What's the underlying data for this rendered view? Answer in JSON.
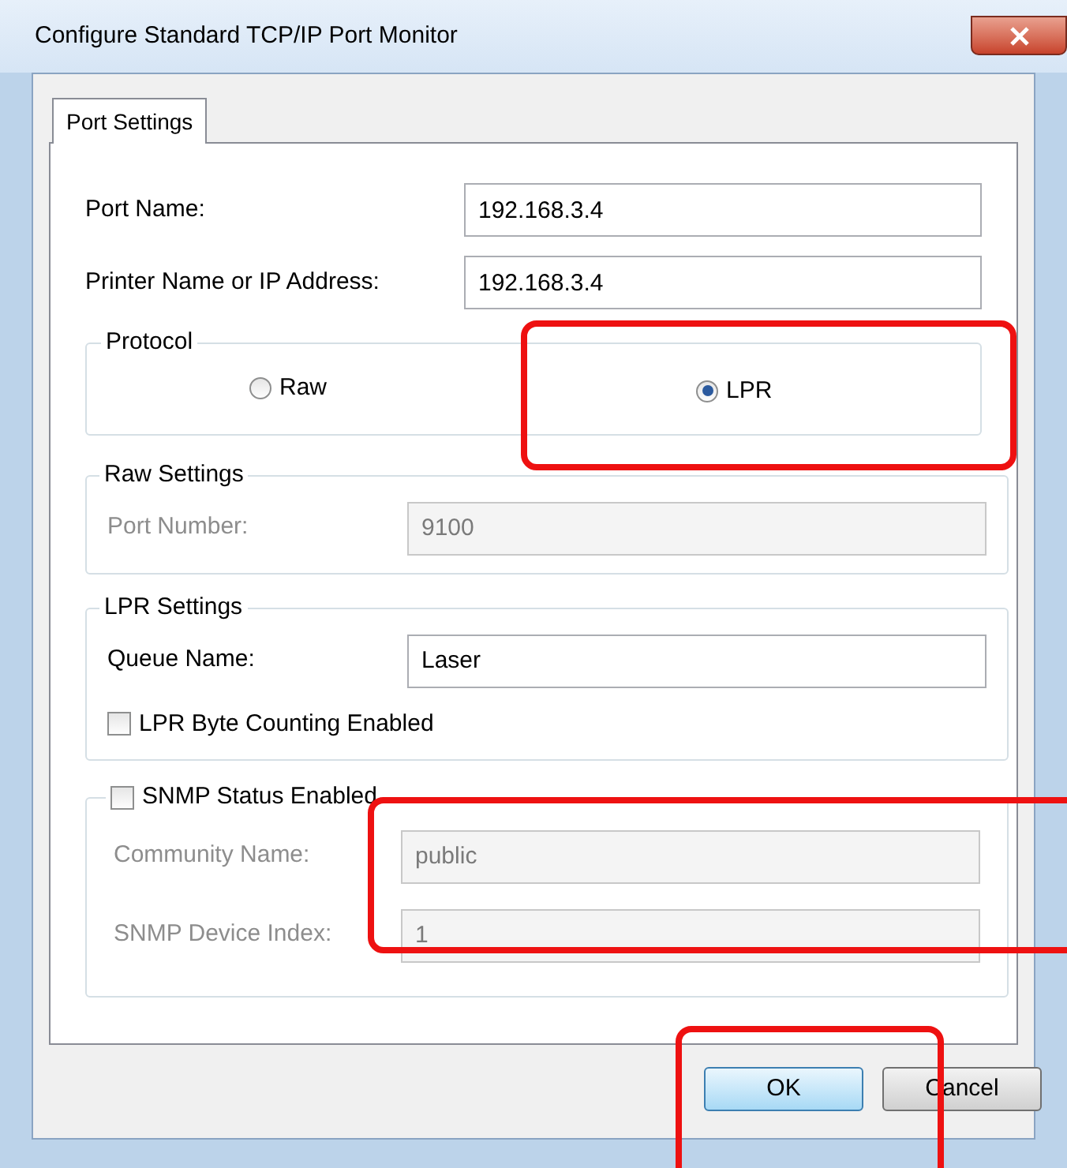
{
  "window": {
    "title": "Configure Standard TCP/IP Port Monitor"
  },
  "tabs": [
    {
      "label": "Port Settings",
      "selected": true
    }
  ],
  "fields": [
    {
      "label": "Port Name:",
      "value": "192.168.3.4"
    },
    {
      "label": "Printer Name or IP Address:",
      "value": "192.168.3.4"
    }
  ],
  "protocol": {
    "title": "Protocol",
    "options": [
      {
        "label": "Raw",
        "selected": false
      },
      {
        "label": "LPR",
        "selected": true
      }
    ]
  },
  "raw_settings": {
    "title": "Raw Settings",
    "disabled": true,
    "port_number": {
      "label": "Port Number:",
      "value": "9100"
    }
  },
  "lpr_settings": {
    "title": "LPR Settings",
    "disabled": false,
    "queue_name": {
      "label": "Queue Name:",
      "value": "Laser"
    },
    "byte_counting": {
      "label": "LPR Byte Counting Enabled",
      "checked": false
    }
  },
  "snmp": {
    "label": "SNMP Status Enabled",
    "checked": false,
    "fields": [
      {
        "label": "Community Name:",
        "value": "public"
      },
      {
        "label": "SNMP Device Index:",
        "value": "1"
      }
    ]
  },
  "buttons": [
    {
      "label": "OK",
      "kind": "default"
    },
    {
      "label": "Cancel",
      "kind": "normal"
    }
  ]
}
